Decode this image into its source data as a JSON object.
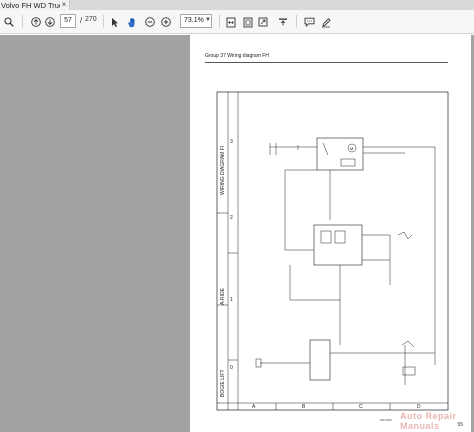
{
  "tab": {
    "title": "Volvo FH WD Truck...",
    "close": "×"
  },
  "toolbar": {
    "current_page": "57",
    "page_separator": "/",
    "total_pages": "270",
    "zoom": "73.1%",
    "icons": [
      "search-icon",
      "prev-page-icon",
      "next-page-icon",
      "pointer-icon",
      "hand-icon",
      "zoom-out-icon",
      "zoom-in-icon",
      "fit-width-icon",
      "fit-page-icon",
      "full-screen-icon",
      "rotate-icon",
      "comment-icon",
      "pen-icon"
    ]
  },
  "page": {
    "header": "Group 37 Wiring diagram FH",
    "side_title": "WIRING DIAGRAM FI",
    "side_section_a_ride": "A-RIDE",
    "side_section_bogie": "BOGIE LIFT",
    "column_numbers": [
      "3",
      "2",
      "1",
      "0"
    ],
    "row_letters": [
      "A",
      "B",
      "C",
      "D"
    ],
    "page_number": "55",
    "footer_code": "DRO965",
    "watermark": "Auto Repair Manuals"
  },
  "colors": {
    "toolbar_bg": "#f7f7f7",
    "tab_bg": "#f2f2f2",
    "viewer_bg": "#a3a3a3"
  }
}
